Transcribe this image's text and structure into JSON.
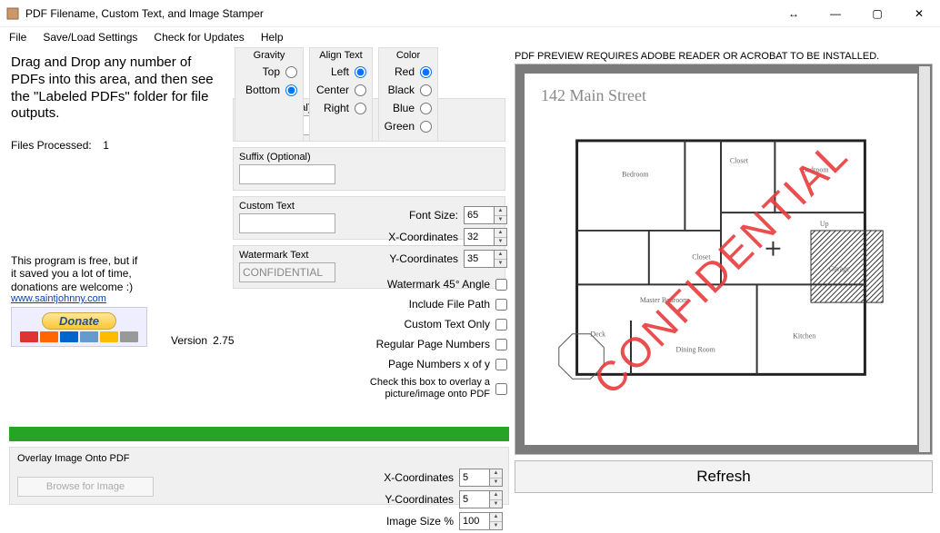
{
  "window": {
    "title": "PDF Filename, Custom Text, and Image Stamper"
  },
  "menu": {
    "file": "File",
    "saveload": "Save/Load Settings",
    "updates": "Check for Updates",
    "help": "Help"
  },
  "instructions": "Drag and Drop any number of PDFs into this area, and then see the \"Labeled PDFs\" folder for file outputs.",
  "files_processed_label": "Files Processed:",
  "files_processed_count": "1",
  "donate": {
    "line1": "This program is free, but if it saved you a lot of time, donations are welcome :)",
    "link": "www.saintjohnny.com",
    "button": "Donate"
  },
  "version_label": "Version",
  "version": "2.75",
  "fields": {
    "prefix_label": "Prefix (Optional)",
    "prefix_val": "",
    "suffix_label": "Suffix (Optional)",
    "suffix_val": "",
    "custom_label": "Custom Text",
    "custom_val": "",
    "watermark_label": "Watermark Text",
    "watermark_val": "CONFIDENTIAL"
  },
  "gravity": {
    "title": "Gravity",
    "top": "Top",
    "bottom": "Bottom",
    "selected": "bottom"
  },
  "align": {
    "title": "Align Text",
    "left": "Left",
    "center": "Center",
    "right": "Right",
    "selected": "left"
  },
  "color": {
    "title": "Color",
    "red": "Red",
    "black": "Black",
    "blue": "Blue",
    "green": "Green",
    "selected": "red"
  },
  "font_size_label": "Font Size:",
  "font_size": "65",
  "xcoord_label": "X-Coordinates",
  "xcoord": "32",
  "ycoord_label": "Y-Coordinates",
  "ycoord": "35",
  "chk": {
    "angle": "Watermark 45° Angle",
    "path": "Include File Path",
    "ctonly": "Custom Text Only",
    "regpn": "Regular Page Numbers",
    "pnxy": "Page Numbers x of y",
    "overlayimg": "Check this box to overlay a picture/image onto PDF"
  },
  "overlay": {
    "section_label": "Overlay Image Onto PDF",
    "browse": "Browse for Image",
    "x_label": "X-Coordinates",
    "x": "5",
    "y_label": "Y-Coordinates",
    "y": "5",
    "size_label": "Image Size %",
    "size": "100"
  },
  "preview": {
    "note": "PDF PREVIEW REQUIRES ADOBE READER OR ACROBAT TO BE INSTALLED.",
    "address": "142 Main Street",
    "stamp": "CONFIDENTIAL",
    "rooms": {
      "bedroom": "Bedroom",
      "bedroom2": "Bedroom",
      "closet": "Closet",
      "closet2": "Closet",
      "master": "Master Bedroom",
      "garage": "Garage",
      "kitchen": "Kitchen",
      "dining": "Dining Room",
      "deck": "Deck",
      "up": "Up"
    }
  },
  "refresh": "Refresh"
}
